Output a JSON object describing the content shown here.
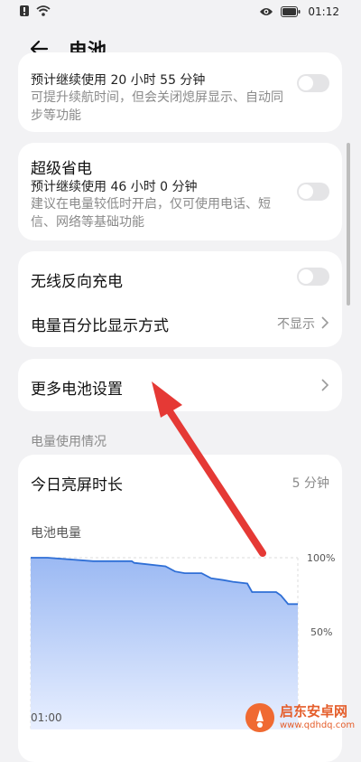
{
  "status_bar": {
    "time": "01:12",
    "icons": [
      "notification-icon",
      "wifi-icon",
      "eye-icon",
      "battery-icon"
    ]
  },
  "header": {
    "title": "电池"
  },
  "card1": {
    "sub": "预计继续使用 20 小时 55 分钟",
    "desc": "可提升续航时间，但会关闭熄屏显示、自动同步等功能"
  },
  "card2": {
    "title": "超级省电",
    "sub": "预计继续使用 46 小时 0 分钟",
    "desc": "建议在电量较低时开启，仅可使用电话、短信、网络等基础功能"
  },
  "card3": {
    "wireless_title": "无线反向充电",
    "percent_title": "电量百分比显示方式",
    "percent_value": "不显示"
  },
  "card4": {
    "title": "更多电池设置"
  },
  "usage": {
    "section_title": "电量使用情况",
    "screen_time_label": "今日亮屏时长",
    "screen_time_value": "5 分钟",
    "chart_title": "电池电量"
  },
  "chart_data": {
    "type": "area",
    "title": "电池电量",
    "x_tick_labels": [
      "01:00"
    ],
    "y_tick_labels": [
      "100%",
      "50%"
    ],
    "ylim": [
      0,
      100
    ],
    "x_hours": [
      0,
      0.35,
      1.3,
      1.5,
      1.75,
      2.1,
      2.15,
      2.8,
      3.0,
      3.2,
      3.55,
      3.75,
      4.0,
      4.2,
      4.5,
      4.6,
      5.1,
      5.2,
      5.35,
      5.55
    ],
    "values": [
      100,
      100,
      98,
      98,
      98,
      98,
      97,
      95,
      92,
      91,
      91,
      88,
      87,
      86,
      85,
      80,
      80,
      78,
      73,
      73
    ],
    "xlim": [
      0,
      5.55
    ],
    "colors": {
      "line": "#2f6fd6",
      "fill_top": "#9bb9f3",
      "fill_bottom": "#e8efff"
    }
  },
  "watermark": {
    "name": "启东安卓网",
    "url": "www.qdhdq.com",
    "color": "#e55e2b"
  }
}
